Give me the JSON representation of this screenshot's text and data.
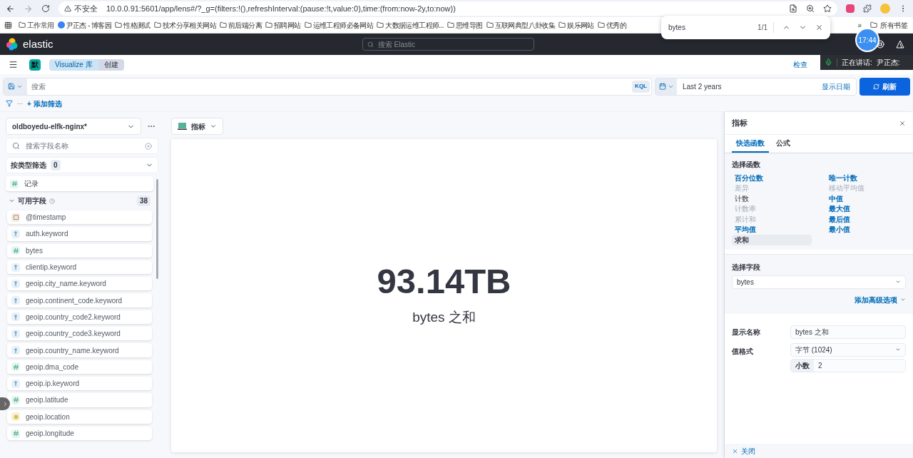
{
  "browser": {
    "security": "不安全",
    "url": "10.0.0.91:5601/app/lens#/?_g=(filters:!(),refreshInterval:(pause:!t,value:0),time:(from:now-2y,to:now))"
  },
  "bookmarks": {
    "items": [
      {
        "label": "工作常用",
        "kind": "folder"
      },
      {
        "label": "尹正杰 - 博客园",
        "kind": "site"
      },
      {
        "label": "性格测试",
        "kind": "folder"
      },
      {
        "label": "技术分享相关网站",
        "kind": "folder"
      },
      {
        "label": "前后端分离",
        "kind": "folder"
      },
      {
        "label": "招聘网站",
        "kind": "folder"
      },
      {
        "label": "运维工程师必备网站",
        "kind": "folder"
      },
      {
        "label": "大数据运维工程师...",
        "kind": "folder"
      },
      {
        "label": "思维导图",
        "kind": "folder"
      },
      {
        "label": "互联网典型八卦收集",
        "kind": "folder"
      },
      {
        "label": "娱乐网站",
        "kind": "folder"
      },
      {
        "label": "优秀的",
        "kind": "folder"
      }
    ],
    "more": "»",
    "all": "所有书签"
  },
  "find_bar": {
    "query": "bytes",
    "count": "1/1"
  },
  "header": {
    "brand": "elastic",
    "search_placeholder": "搜索 Elastic"
  },
  "clock": "17:44",
  "speaking": {
    "label": "正在讲话:",
    "name": "尹正杰:"
  },
  "nav": {
    "space": "默",
    "breadcrumbs": [
      {
        "label": "Visualize 库",
        "selected": false
      },
      {
        "label": "创建",
        "selected": true
      }
    ],
    "inspect": "检查"
  },
  "query_bar": {
    "placeholder": "搜索",
    "language": "KQL",
    "time": "Last 2 years",
    "show_dates": "显示日期",
    "refresh": "刷新",
    "add_filter": "+ 添加筛选"
  },
  "sidebar": {
    "index_pattern": "oldboyedu-elfk-nginx*",
    "field_search_placeholder": "搜索字段名称",
    "type_filter": "按类型筛选",
    "type_filter_count": "0",
    "records": "记录",
    "available_label": "可用字段",
    "available_count": "38",
    "fields": [
      {
        "name": "@timestamp",
        "kind": "date"
      },
      {
        "name": "auth.keyword",
        "kind": "text"
      },
      {
        "name": "bytes",
        "kind": "number"
      },
      {
        "name": "clientip.keyword",
        "kind": "text"
      },
      {
        "name": "geoip.city_name.keyword",
        "kind": "text"
      },
      {
        "name": "geoip.continent_code.keyword",
        "kind": "text"
      },
      {
        "name": "geoip.country_code2.keyword",
        "kind": "text"
      },
      {
        "name": "geoip.country_code3.keyword",
        "kind": "text"
      },
      {
        "name": "geoip.country_name.keyword",
        "kind": "text"
      },
      {
        "name": "geoip.dma_code",
        "kind": "number"
      },
      {
        "name": "geoip.ip.keyword",
        "kind": "text"
      },
      {
        "name": "geoip.latitude",
        "kind": "number"
      },
      {
        "name": "geoip.location",
        "kind": "geo"
      },
      {
        "name": "geoip.longitude",
        "kind": "number"
      }
    ]
  },
  "workspace": {
    "chart_type": "指标",
    "value": "93.14TB",
    "label": "bytes 之和"
  },
  "flyout": {
    "title": "指标",
    "tabs": [
      {
        "label": "快选函数",
        "selected": true
      },
      {
        "label": "公式",
        "selected": false
      }
    ],
    "functions_label": "选择函数",
    "functions": [
      {
        "label": "百分位数",
        "kind": "link",
        "selected": false
      },
      {
        "label": "差异",
        "kind": "muted",
        "selected": false
      },
      {
        "label": "计数",
        "kind": "plain",
        "selected": false
      },
      {
        "label": "计数率",
        "kind": "muted",
        "selected": false
      },
      {
        "label": "累计和",
        "kind": "muted",
        "selected": false
      },
      {
        "label": "平均值",
        "kind": "link",
        "selected": false
      },
      {
        "label": "求和",
        "kind": "plain",
        "selected": true
      },
      {
        "label": "唯一计数",
        "kind": "link",
        "selected": false
      },
      {
        "label": "移动平均值",
        "kind": "muted",
        "selected": false
      },
      {
        "label": "中值",
        "kind": "link",
        "selected": false
      },
      {
        "label": "最大值",
        "kind": "link",
        "selected": false
      },
      {
        "label": "最后值",
        "kind": "link",
        "selected": false
      },
      {
        "label": "最小值",
        "kind": "link",
        "selected": false
      }
    ],
    "field_label": "选择字段",
    "field": "bytes",
    "advanced": "添加高级选项",
    "display_name_label": "显示名称",
    "display_name": "bytes 之和",
    "format_label": "值格式",
    "format": "字节 (1024)",
    "decimals_label": "小数",
    "decimals": "2",
    "close": "关闭"
  }
}
